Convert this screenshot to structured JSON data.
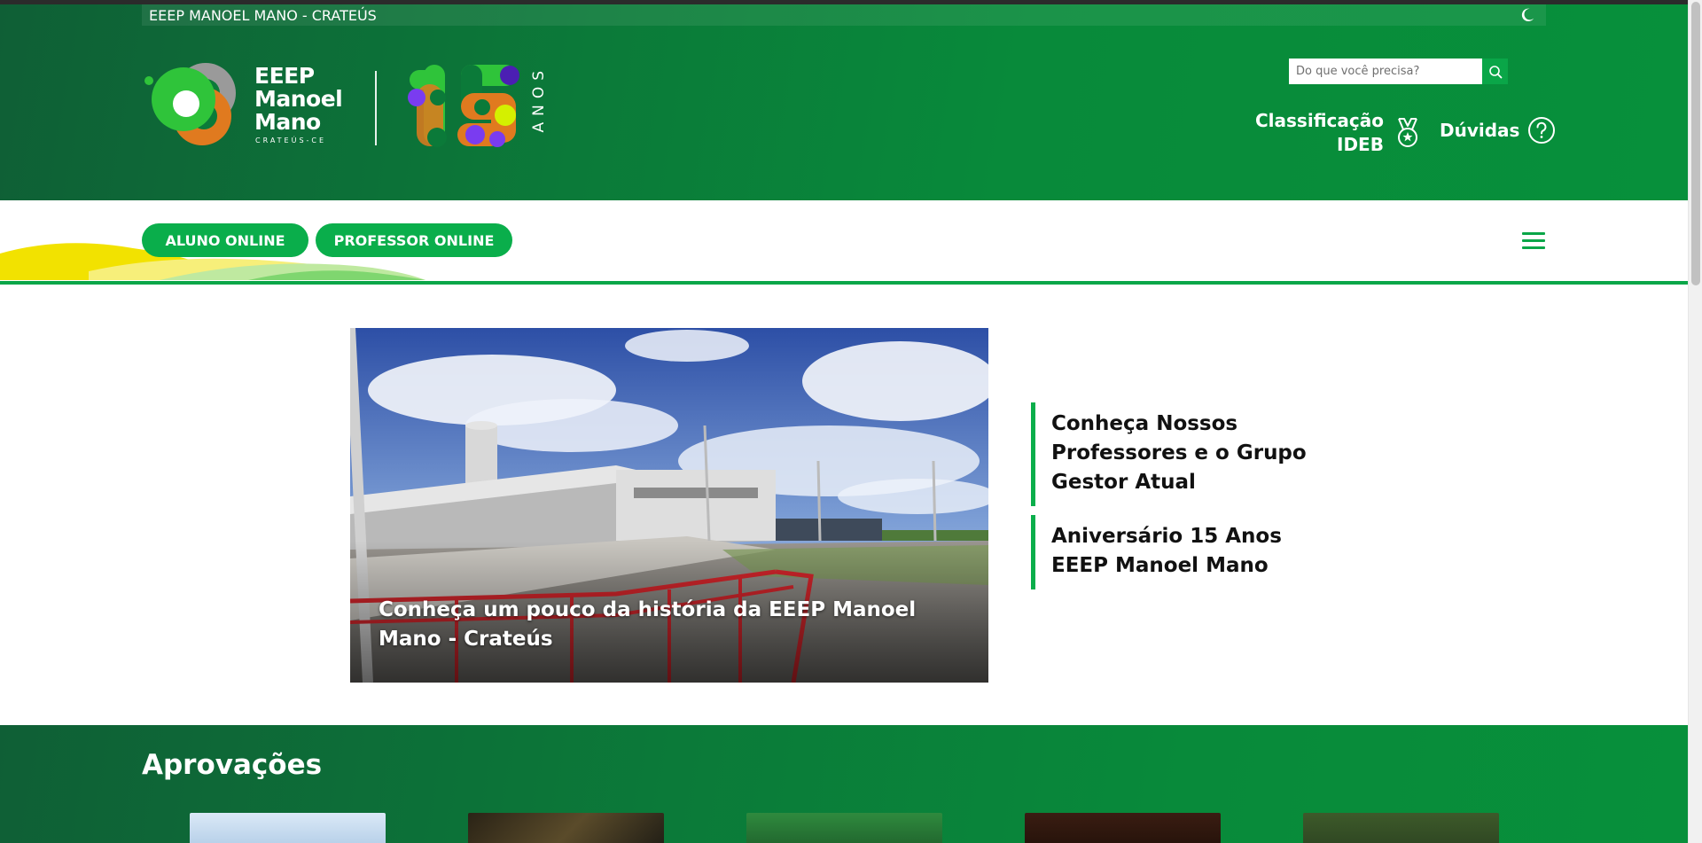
{
  "topbar": {
    "title": "EEEP MANOEL MANO - CRATEÚS",
    "theme_icon": "moon-icon"
  },
  "logo": {
    "line1": "EEEP",
    "line2": "Manoel",
    "line3": "Mano",
    "subtitle": "CRATEÚS-CE"
  },
  "anniversary": {
    "number": "15",
    "word": "ANOS"
  },
  "search": {
    "placeholder": "Do que você precisa?",
    "icon": "search-icon"
  },
  "header_links": {
    "ideb_line1": "Classificação",
    "ideb_line2": "IDEB",
    "ideb_icon": "medal-icon",
    "duvidas": "Dúvidas",
    "duvidas_icon": "help-circle-icon"
  },
  "nav": {
    "aluno": "ALUNO ONLINE",
    "professor": "PROFESSOR ONLINE",
    "menu_icon": "hamburger-menu-icon"
  },
  "featured": {
    "caption": "Conheça um pouco da história da EEEP Manoel Mano - Crateús"
  },
  "news": [
    {
      "title": "Conheça Nossos Professores e o Grupo Gestor Atual"
    },
    {
      "title": "Aniversário 15 Anos EEEP Manoel Mano"
    }
  ],
  "approvals": {
    "title": "Aprovações"
  },
  "colors": {
    "primary": "#0aae4b",
    "header_dark": "#0f5f36"
  }
}
